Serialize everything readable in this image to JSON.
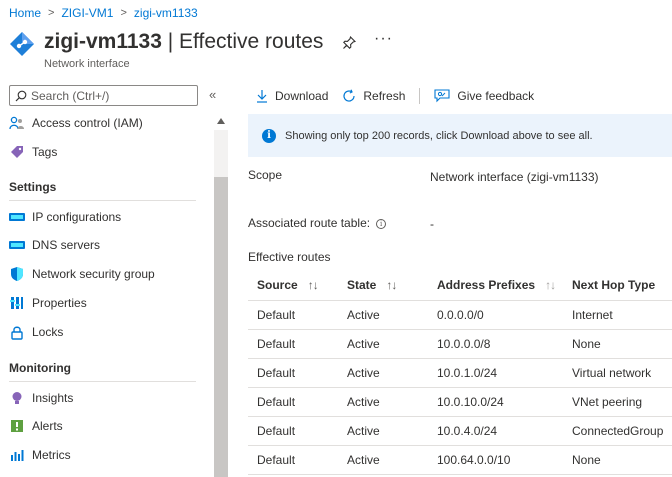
{
  "breadcrumb": {
    "items": [
      "Home",
      "ZIGI-VM1",
      "zigi-vm1133"
    ]
  },
  "header": {
    "title_name": "zigi-vm1133",
    "title_rest": " | Effective routes",
    "subtitle": "Network interface",
    "more": "···"
  },
  "sidebar": {
    "search_placeholder": "Search (Ctrl+/)",
    "collapse": "«",
    "top_items": [
      {
        "label": "Access control (IAM)",
        "icon": "people-icon"
      },
      {
        "label": "Tags",
        "icon": "tag-icon"
      }
    ],
    "settings_heading": "Settings",
    "settings_items": [
      {
        "label": "IP configurations",
        "icon": "ip-config-icon"
      },
      {
        "label": "DNS servers",
        "icon": "dns-icon"
      },
      {
        "label": "Network security group",
        "icon": "shield-icon"
      },
      {
        "label": "Properties",
        "icon": "properties-icon"
      },
      {
        "label": "Locks",
        "icon": "lock-icon"
      }
    ],
    "monitoring_heading": "Monitoring",
    "monitoring_items": [
      {
        "label": "Insights",
        "icon": "lightbulb-icon"
      },
      {
        "label": "Alerts",
        "icon": "alert-icon"
      },
      {
        "label": "Metrics",
        "icon": "metrics-icon"
      }
    ]
  },
  "toolbar": {
    "download": "Download",
    "refresh": "Refresh",
    "feedback": "Give feedback"
  },
  "banner": {
    "text": "Showing only top 200 records, click Download above to see all."
  },
  "scope": {
    "label": "Scope",
    "value": "Network interface (zigi-vm1133)"
  },
  "route_table": {
    "label": "Associated route table:",
    "value": "-"
  },
  "effective_routes": {
    "heading": "Effective routes",
    "columns": [
      "Source",
      "State",
      "Address Prefixes",
      "Next Hop Type"
    ],
    "rows": [
      [
        "Default",
        "Active",
        "0.0.0.0/0",
        "Internet"
      ],
      [
        "Default",
        "Active",
        "10.0.0.0/8",
        "None"
      ],
      [
        "Default",
        "Active",
        "10.0.1.0/24",
        "Virtual network"
      ],
      [
        "Default",
        "Active",
        "10.0.10.0/24",
        "VNet peering"
      ],
      [
        "Default",
        "Active",
        "10.0.4.0/24",
        "ConnectedGroup"
      ],
      [
        "Default",
        "Active",
        "100.64.0.0/10",
        "None"
      ]
    ]
  },
  "colors": {
    "accent": "#0078d4",
    "banner_bg": "#ebf3fc",
    "text": "#323130"
  }
}
